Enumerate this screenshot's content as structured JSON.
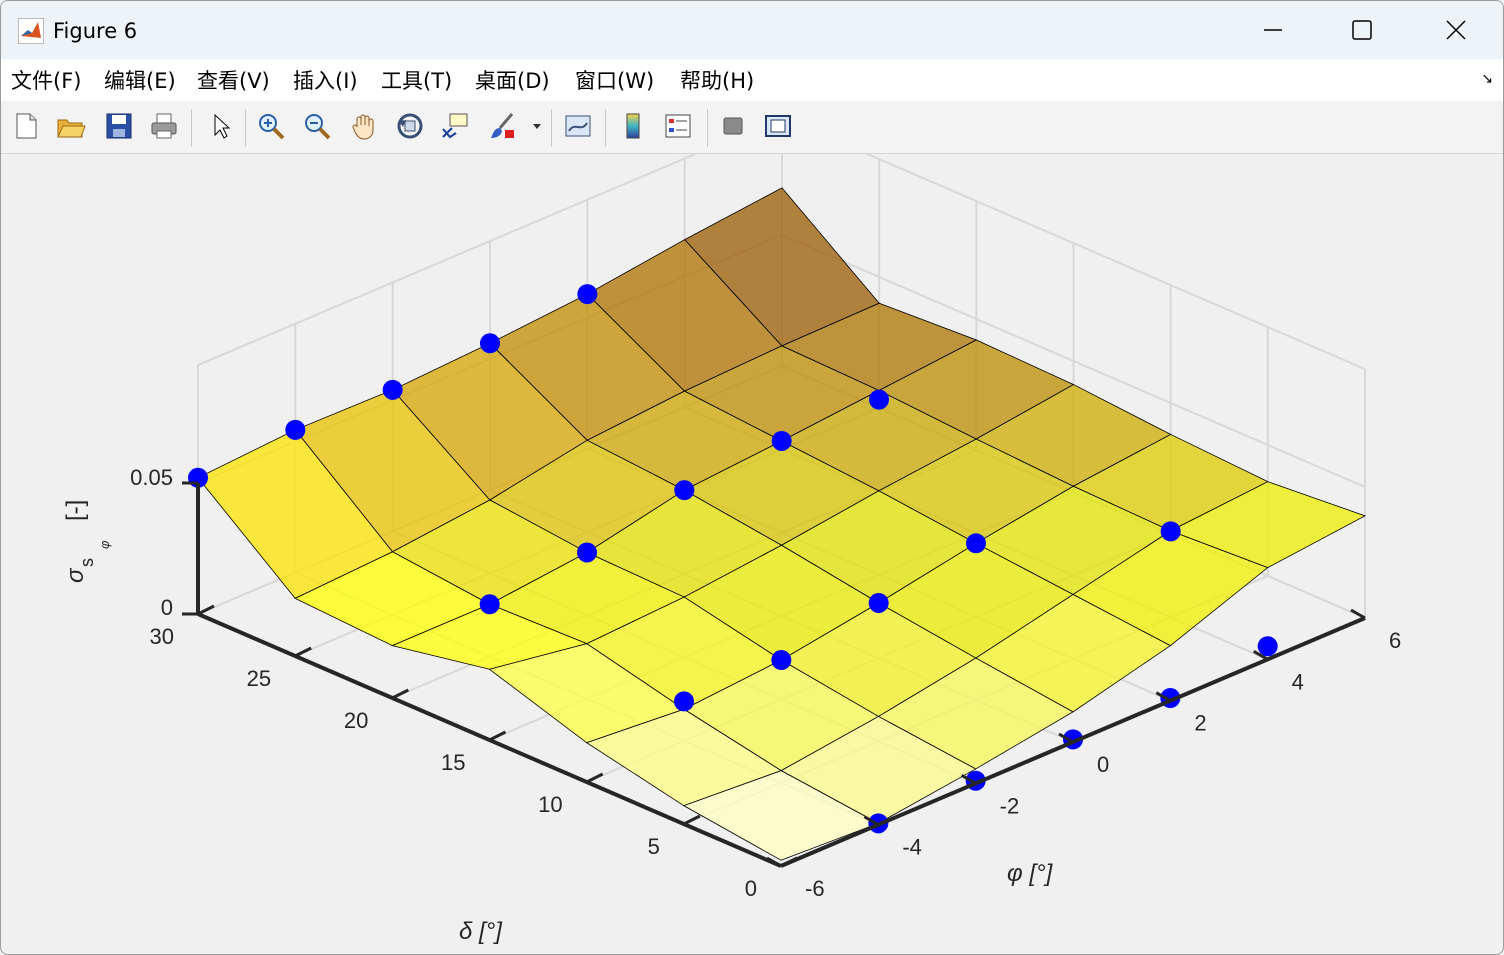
{
  "window": {
    "title": "Figure 6"
  },
  "menu": {
    "items": [
      {
        "label": "文件(F)"
      },
      {
        "label": "编辑(E)"
      },
      {
        "label": "查看(V)"
      },
      {
        "label": "插入(I)"
      },
      {
        "label": "工具(T)"
      },
      {
        "label": "桌面(D)"
      },
      {
        "label": "窗口(W)"
      },
      {
        "label": "帮助(H)"
      }
    ]
  },
  "toolbar": {
    "icons": [
      "new-figure-icon",
      "open-file-icon",
      "save-icon",
      "print-icon",
      "select-arrow-icon",
      "zoom-in-icon",
      "zoom-out-icon",
      "pan-hand-icon",
      "rotate-3d-icon",
      "data-cursor-icon",
      "brush-icon",
      "brush-dropdown-icon",
      "link-plot-icon",
      "colorbar-icon",
      "legend-icon",
      "hide-plot-tools-icon",
      "show-plot-tools-icon"
    ]
  },
  "chart_data": {
    "type": "surface",
    "title": "",
    "xlabel": "φ  [°]",
    "ylabel": "δ  [°]",
    "zlabel": "σ",
    "zlabel_sub": "s",
    "zlabel_subsub": "φ",
    "zlabel_unit": "[-]",
    "x_ticks": [
      "-6",
      "-4",
      "-2",
      "0",
      "2",
      "4",
      "6"
    ],
    "y_ticks": [
      "0",
      "5",
      "10",
      "15",
      "20",
      "25",
      "30"
    ],
    "z_ticks": [
      "0",
      "0.05"
    ],
    "xlim": [
      -6,
      6
    ],
    "ylim": [
      0,
      30
    ],
    "zlim": [
      0,
      0.05
    ],
    "grid": true,
    "colormap": "hot",
    "marker_color": "#0000ff",
    "phi": [
      -6,
      -4,
      -2,
      0,
      2,
      4,
      6
    ],
    "delta": [
      0,
      5,
      10,
      15,
      20,
      25,
      30
    ],
    "sigma": [
      [
        0.0022,
        0.0005,
        0.0055,
        0.0115,
        0.021,
        0.035,
        0.039
      ],
      [
        0.007,
        0.0046,
        0.0095,
        0.016,
        0.0245,
        0.033,
        0.036
      ],
      [
        0.015,
        0.012,
        0.015,
        0.021,
        0.028,
        0.034,
        0.038
      ],
      [
        0.027,
        0.021,
        0.023,
        0.027,
        0.032,
        0.036,
        0.041
      ],
      [
        0.02,
        0.02,
        0.024,
        0.032,
        0.035,
        0.0385,
        0.042
      ],
      [
        0.022,
        0.024,
        0.028,
        0.035,
        0.038,
        0.0395,
        0.04
      ],
      [
        0.052,
        0.0545,
        0.054,
        0.056,
        0.059,
        0.064,
        0.068
      ]
    ],
    "markers": [
      {
        "phi": -4,
        "delta": 0,
        "sigma": 0.0005
      },
      {
        "phi": -2,
        "delta": 0,
        "sigma": 0.001
      },
      {
        "phi": 0,
        "delta": 0,
        "sigma": 0.001
      },
      {
        "phi": 2,
        "delta": 0,
        "sigma": 0.001
      },
      {
        "phi": 4,
        "delta": 0,
        "sigma": 0.005
      },
      {
        "phi": -4,
        "delta": 10,
        "sigma": 0.015
      },
      {
        "phi": -2,
        "delta": 10,
        "sigma": 0.015
      },
      {
        "phi": 0,
        "delta": 10,
        "sigma": 0.021
      },
      {
        "phi": 2,
        "delta": 10,
        "sigma": 0.028
      },
      {
        "phi": -4,
        "delta": 20,
        "sigma": 0.02
      },
      {
        "phi": -2,
        "delta": 20,
        "sigma": 0.024
      },
      {
        "phi": 0,
        "delta": 20,
        "sigma": 0.032
      },
      {
        "phi": 2,
        "delta": 20,
        "sigma": 0.035
      },
      {
        "phi": -6,
        "delta": 30,
        "sigma": 0.052
      },
      {
        "phi": -4,
        "delta": 30,
        "sigma": 0.0545
      },
      {
        "phi": -2,
        "delta": 30,
        "sigma": 0.054
      },
      {
        "phi": 0,
        "delta": 30,
        "sigma": 0.056
      },
      {
        "phi": 2,
        "delta": 30,
        "sigma": 0.059
      },
      {
        "phi": 6,
        "delta": 10,
        "sigma": 0.001
      },
      {
        "phi": 4,
        "delta": 20,
        "sigma": 0.035
      }
    ]
  }
}
